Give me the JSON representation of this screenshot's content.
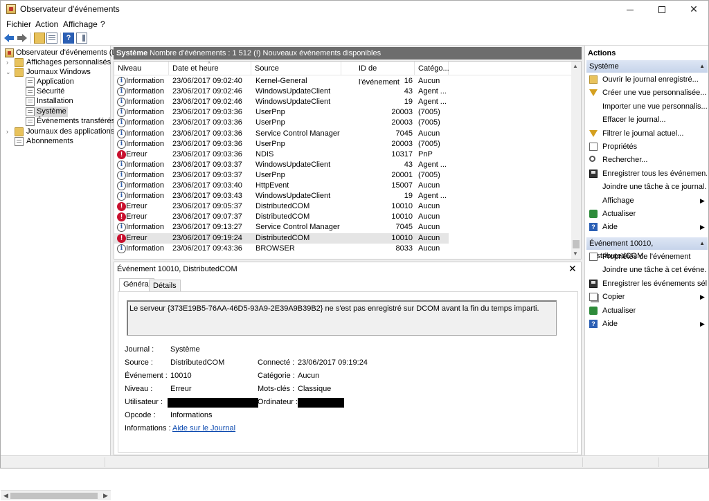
{
  "window": {
    "title": "Observateur d'événements"
  },
  "menu": [
    "Fichier",
    "Action",
    "Affichage",
    "?"
  ],
  "tree": {
    "items": [
      {
        "label": "Observateur d'événements (Loc"
      },
      {
        "label": "Affichages personnalisés"
      },
      {
        "label": "Journaux Windows"
      },
      {
        "label": "Application"
      },
      {
        "label": "Sécurité"
      },
      {
        "label": "Installation"
      },
      {
        "label": "Système"
      },
      {
        "label": "Événements transférés"
      },
      {
        "label": "Journaux des applications et"
      },
      {
        "label": "Abonnements"
      }
    ]
  },
  "center": {
    "log_name": "Système",
    "event_count": "Nombre d'événements : 1 512 (!) Nouveaux événements disponibles",
    "columns": [
      "Niveau",
      "Date et heure",
      "Source",
      "ID de l'événement",
      "Catégo..."
    ],
    "rows": [
      {
        "level": "Information",
        "date": "23/06/2017 09:02:40",
        "source": "Kernel-General",
        "id": "16",
        "category": "Aucun"
      },
      {
        "level": "Information",
        "date": "23/06/2017 09:02:46",
        "source": "WindowsUpdateClient",
        "id": "43",
        "category": "Agent ..."
      },
      {
        "level": "Information",
        "date": "23/06/2017 09:02:46",
        "source": "WindowsUpdateClient",
        "id": "19",
        "category": "Agent ..."
      },
      {
        "level": "Information",
        "date": "23/06/2017 09:03:36",
        "source": "UserPnp",
        "id": "20003",
        "category": "(7005)"
      },
      {
        "level": "Information",
        "date": "23/06/2017 09:03:36",
        "source": "UserPnp",
        "id": "20003",
        "category": "(7005)"
      },
      {
        "level": "Information",
        "date": "23/06/2017 09:03:36",
        "source": "Service Control Manager",
        "id": "7045",
        "category": "Aucun"
      },
      {
        "level": "Information",
        "date": "23/06/2017 09:03:36",
        "source": "UserPnp",
        "id": "20003",
        "category": "(7005)"
      },
      {
        "level": "Erreur",
        "date": "23/06/2017 09:03:36",
        "source": "NDIS",
        "id": "10317",
        "category": "PnP"
      },
      {
        "level": "Information",
        "date": "23/06/2017 09:03:37",
        "source": "WindowsUpdateClient",
        "id": "43",
        "category": "Agent ..."
      },
      {
        "level": "Information",
        "date": "23/06/2017 09:03:37",
        "source": "UserPnp",
        "id": "20001",
        "category": "(7005)"
      },
      {
        "level": "Information",
        "date": "23/06/2017 09:03:40",
        "source": "HttpEvent",
        "id": "15007",
        "category": "Aucun"
      },
      {
        "level": "Information",
        "date": "23/06/2017 09:03:43",
        "source": "WindowsUpdateClient",
        "id": "19",
        "category": "Agent ..."
      },
      {
        "level": "Erreur",
        "date": "23/06/2017 09:05:37",
        "source": "DistributedCOM",
        "id": "10010",
        "category": "Aucun"
      },
      {
        "level": "Erreur",
        "date": "23/06/2017 09:07:37",
        "source": "DistributedCOM",
        "id": "10010",
        "category": "Aucun"
      },
      {
        "level": "Information",
        "date": "23/06/2017 09:13:27",
        "source": "Service Control Manager",
        "id": "7045",
        "category": "Aucun"
      },
      {
        "level": "Erreur",
        "date": "23/06/2017 09:19:24",
        "source": "DistributedCOM",
        "id": "10010",
        "category": "Aucun",
        "selected": true
      },
      {
        "level": "Information",
        "date": "23/06/2017 09:43:36",
        "source": "BROWSER",
        "id": "8033",
        "category": "Aucun"
      }
    ]
  },
  "detail": {
    "title": "Événement 10010, DistributedCOM",
    "tabs": [
      "Général",
      "Détails"
    ],
    "message": "Le serveur {373E19B5-76AA-46D5-93A9-2E39A9B39B2} ne s'est pas enregistré sur DCOM avant la fin du temps imparti.",
    "labels": {
      "journal": "Journal :",
      "source": "Source :",
      "event": "Événement :",
      "level": "Niveau :",
      "user": "Utilisateur :",
      "opcode": "Opcode :",
      "info": "Informations :",
      "connected": "Connecté :",
      "category": "Catégorie :",
      "keywords": "Mots-clés :",
      "computer": "Ordinateur :"
    },
    "values": {
      "journal": "Système",
      "source": "DistributedCOM",
      "event": "10010",
      "level": "Erreur",
      "opcode": "Informations",
      "info_link": "Aide sur le Journal",
      "connected": "23/06/2017 09:19:24",
      "category": "Aucun",
      "keywords": "Classique"
    }
  },
  "actions": {
    "header": "Actions",
    "section1": "Système",
    "items1": [
      "Ouvrir le journal enregistré...",
      "Créer une vue personnalisée...",
      "Importer une vue personnalis...",
      "Effacer le journal...",
      "Filtrer le journal actuel...",
      "Propriétés",
      "Rechercher...",
      "Enregistrer tous les événemen...",
      "Joindre une tâche à ce journal...",
      "Affichage",
      "Actualiser",
      "Aide"
    ],
    "section2": "Événement 10010, DistributedCOM",
    "items2": [
      "Propriétés de l'événement",
      "Joindre une tâche à cet événe...",
      "Enregistrer les événements sél...",
      "Copier",
      "Actualiser",
      "Aide"
    ]
  }
}
